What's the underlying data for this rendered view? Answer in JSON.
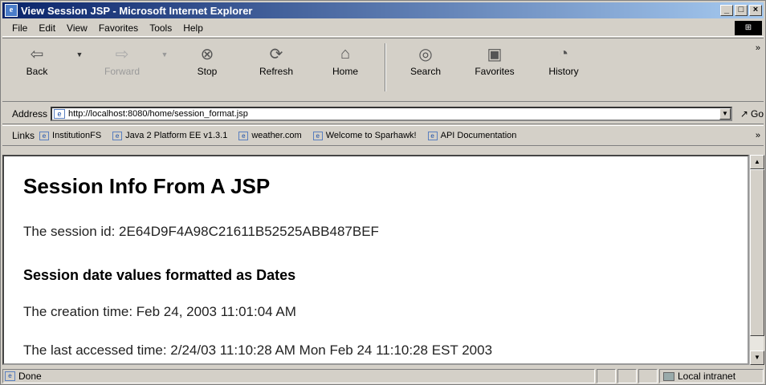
{
  "window": {
    "title": "View Session JSP - Microsoft Internet Explorer",
    "controls": {
      "minimize": "_",
      "maximize": "□",
      "close": "×"
    }
  },
  "menu": [
    "File",
    "Edit",
    "View",
    "Favorites",
    "Tools",
    "Help"
  ],
  "toolbar": {
    "back": "Back",
    "forward": "Forward",
    "stop": "Stop",
    "refresh": "Refresh",
    "home": "Home",
    "search": "Search",
    "favorites": "Favorites",
    "history": "History",
    "more": "»"
  },
  "address": {
    "label": "Address",
    "url": "http://localhost:8080/home/session_format.jsp",
    "go": "Go"
  },
  "links": {
    "label": "Links",
    "items": [
      "InstitutionFS",
      "Java 2 Platform EE v1.3.1",
      "weather.com",
      "Welcome to Sparhawk!",
      "API Documentation"
    ],
    "more": "»"
  },
  "page": {
    "heading": "Session Info From A JSP",
    "session_id": "The session id: 2E64D9F4A98C21611B52525ABB487BEF",
    "subheading": "Session date values formatted as Dates",
    "creation": "The creation time: Feb 24, 2003 11:01:04 AM",
    "last_accessed": "The last accessed time: 2/24/03 11:10:28 AM Mon Feb 24 11:10:28 EST 2003"
  },
  "status": {
    "text": "Done",
    "zone": "Local intranet"
  }
}
